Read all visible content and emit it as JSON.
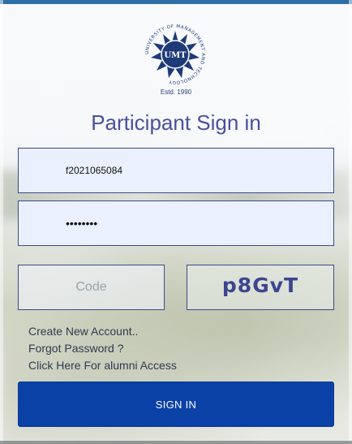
{
  "logo": {
    "ring_text": "UNIVERSITY OF MANAGEMENT AND TECHNOLOGY",
    "mark": "UMT",
    "established": "Estd. 1990"
  },
  "title": "Participant Sign in",
  "form": {
    "username_value": "f2021065084",
    "password_value": "••••••••",
    "code_placeholder": "Code",
    "captcha_text": "p8GvT"
  },
  "links": {
    "create_account": "Create New Account..",
    "forgot_password": "Forgot Password ?",
    "alumni_access": "Click Here For alumni Access"
  },
  "signin_label": "SIGN IN",
  "colors": {
    "accent": "#0a41a6",
    "title": "#4a4f9c",
    "top_bar": "#2f6fa8"
  }
}
